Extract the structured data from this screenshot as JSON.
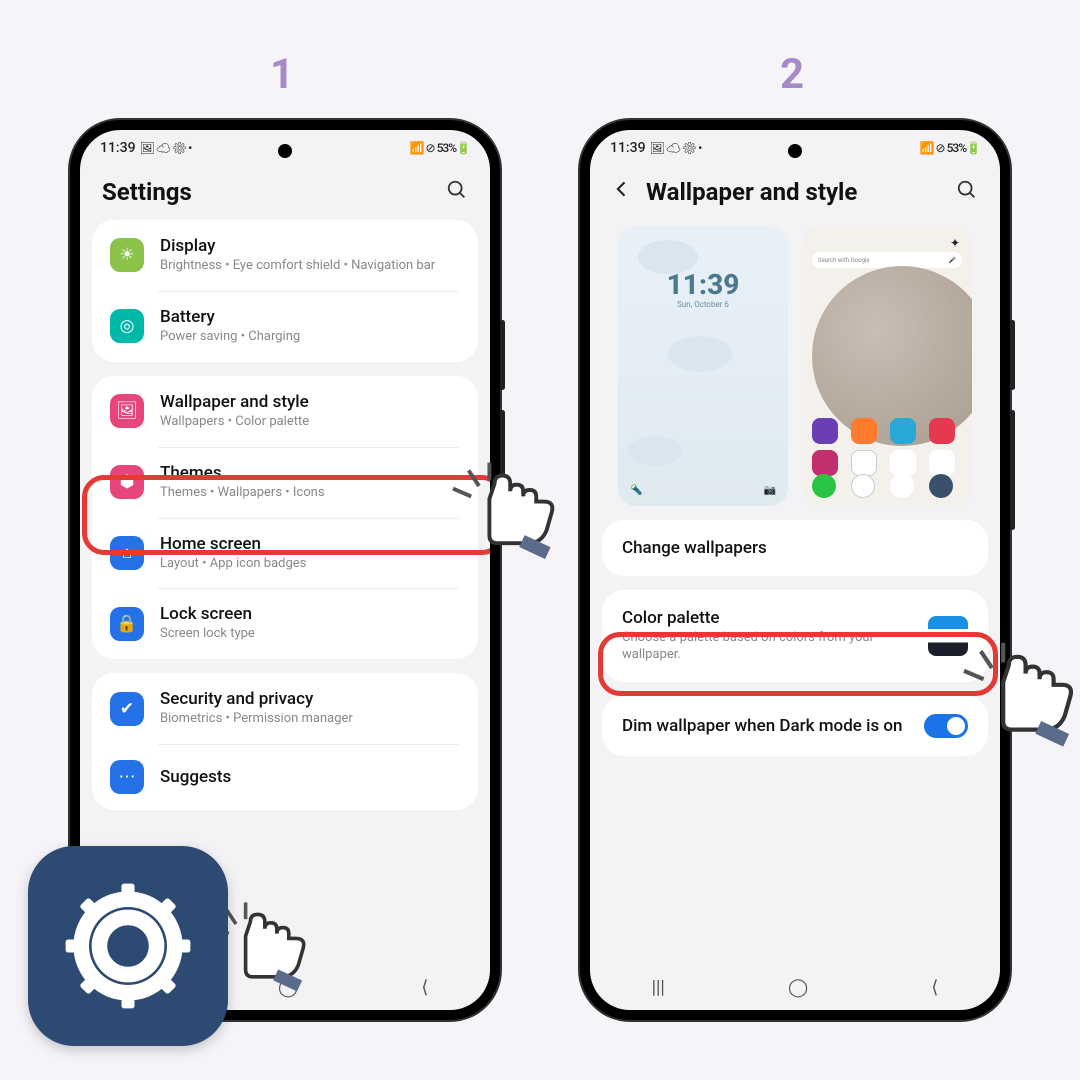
{
  "step_labels": {
    "one": "1",
    "two": "2"
  },
  "status": {
    "time": "11:39",
    "left_icons": "🖼 ☁ ⚙ •",
    "right_icons": "📶 ⊘ 53%🔋",
    "battery": "53%"
  },
  "screen1": {
    "title": "Settings",
    "items": [
      {
        "key": "display",
        "title": "Display",
        "sub": "Brightness  •  Eye comfort shield  •  Navigation bar",
        "icon": "☀"
      },
      {
        "key": "battery",
        "title": "Battery",
        "sub": "Power saving  •  Charging",
        "icon": "◎"
      },
      {
        "key": "wallpaper",
        "title": "Wallpaper and style",
        "sub": "Wallpapers  •  Color palette",
        "icon": "🖼"
      },
      {
        "key": "themes",
        "title": "Themes",
        "sub": "Themes  •  Wallpapers  •  Icons",
        "icon": "⬢"
      },
      {
        "key": "home",
        "title": "Home screen",
        "sub": "Layout  •  App icon badges",
        "icon": "⌂"
      },
      {
        "key": "lock",
        "title": "Lock screen",
        "sub": "Screen lock type",
        "icon": "🔒"
      },
      {
        "key": "security",
        "title": "Security and privacy",
        "sub": "Biometrics  •  Permission manager",
        "icon": "✔"
      }
    ],
    "partial_row": "Suggests"
  },
  "screen2": {
    "title": "Wallpaper and style",
    "lock_preview": {
      "time": "11:39",
      "date": "Sun, October 6"
    },
    "home_preview": {
      "search": "Search with Google"
    },
    "rows": {
      "change": "Change wallpapers",
      "palette_title": "Color palette",
      "palette_sub": "Choose a palette based on colors from your wallpaper.",
      "dim": "Dim wallpaper when Dark mode is on"
    }
  },
  "nav": {
    "recents": "|||",
    "home": "◯",
    "back": "⟨"
  }
}
